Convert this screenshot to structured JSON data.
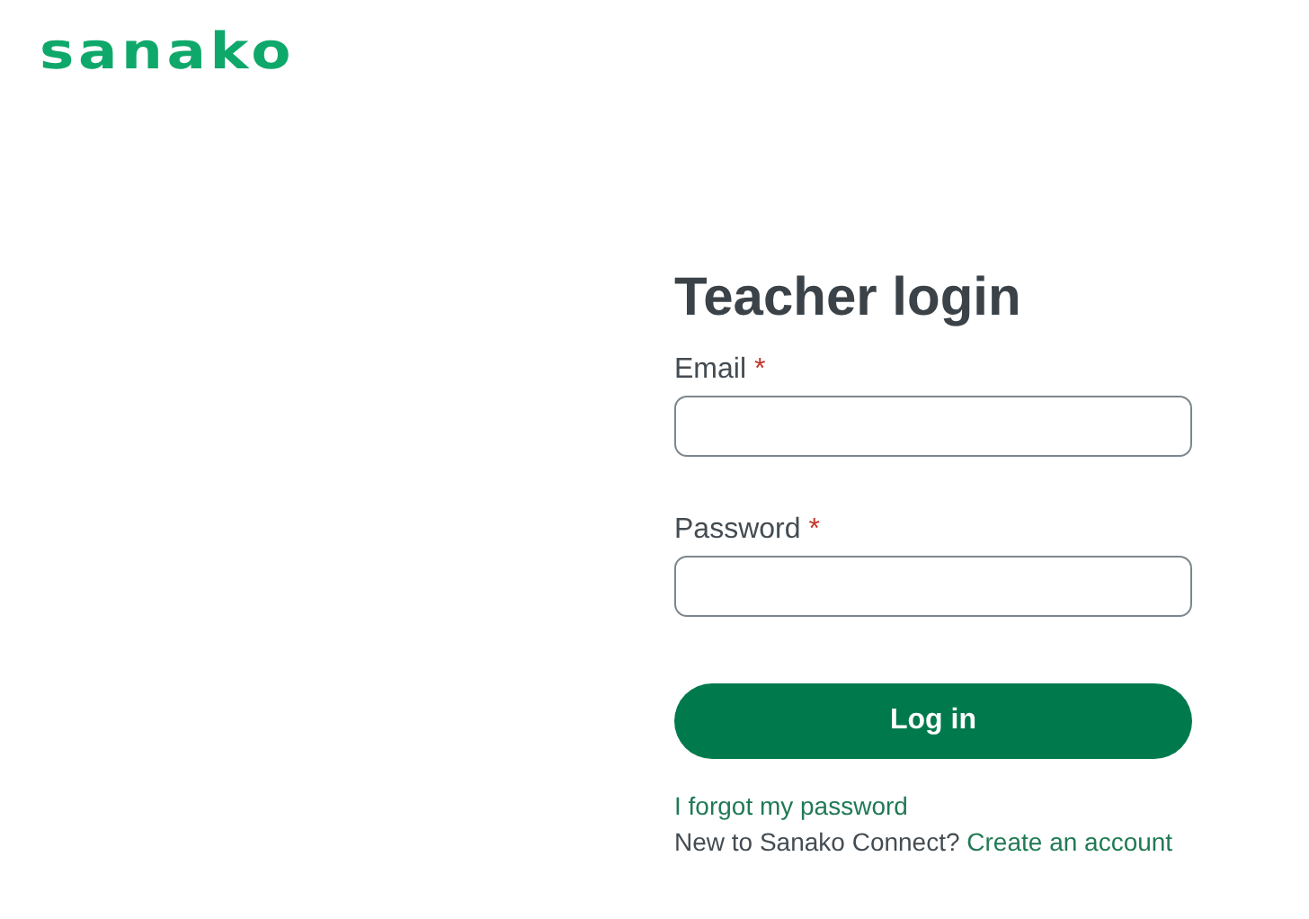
{
  "logo": {
    "text": "sanako"
  },
  "title": "Teacher login",
  "fields": [
    {
      "label": "Email",
      "required_mark": "*"
    },
    {
      "label": "Password",
      "required_mark": "*"
    }
  ],
  "submit": "Log in",
  "forgot_link": "I forgot my password",
  "signup": {
    "prompt": "New to Sanako Connect?",
    "link": "Create an account"
  }
}
